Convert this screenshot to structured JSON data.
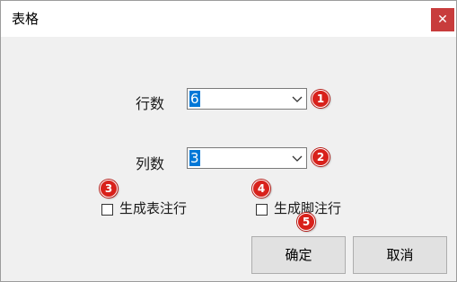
{
  "dialog": {
    "title": "表格",
    "close_glyph": "✕"
  },
  "rows": {
    "label": "行数",
    "value": "6",
    "badge": "1"
  },
  "columns": {
    "label": "列数",
    "value": "3",
    "badge": "2"
  },
  "table_note": {
    "label": "生成表注行",
    "checked": false,
    "badge": "3"
  },
  "footer_note": {
    "label": "生成脚注行",
    "checked": false,
    "badge": "4"
  },
  "ok_button": {
    "label": "确定",
    "badge": "5"
  },
  "cancel_button": {
    "label": "取消"
  },
  "colors": {
    "badge": "#d8211b",
    "selection": "#0078d7",
    "close": "#c83c3c"
  }
}
